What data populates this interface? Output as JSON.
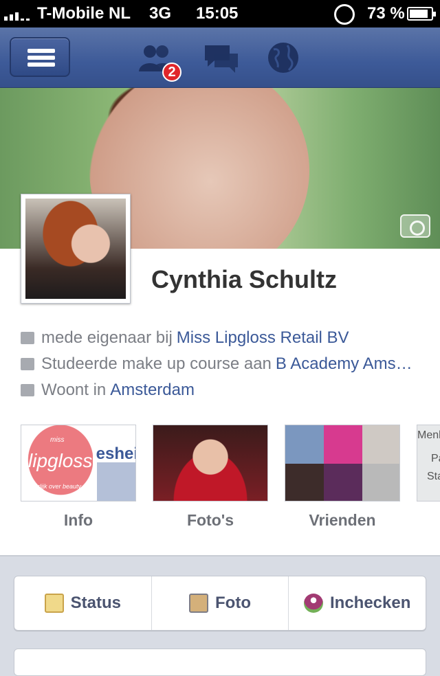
{
  "status_bar": {
    "carrier": "T-Mobile NL",
    "network": "3G",
    "time": "15:05",
    "battery": "73 %"
  },
  "nav": {
    "friend_requests_badge": "2"
  },
  "profile": {
    "name": "Cynthia Schultz",
    "work_prefix": "mede eigenaar bij",
    "work_link": "Miss Lipgloss Retail BV",
    "study_prefix": "Studeerde make up course aan",
    "study_link": "B Academy Ams…",
    "lives_prefix": "Woont in",
    "lives_link": "Amsterdam"
  },
  "tiles": [
    {
      "label": "Info",
      "logo_line1": "miss",
      "logo_line2": "lipgloss",
      "logo_line3": "eerlijk over beauty",
      "partial_text": "eshei"
    },
    {
      "label": "Foto's"
    },
    {
      "label": "Vrienden"
    },
    {
      "label": "",
      "partial_text_1": "Menlo",
      "partial_text_2": "Pa",
      "partial_text_3": "Sta"
    }
  ],
  "actions": {
    "status": "Status",
    "foto": "Foto",
    "checkin": "Inchecken"
  },
  "colors": {
    "facebook_blue": "#3b5998",
    "badge_red": "#e0262b"
  }
}
